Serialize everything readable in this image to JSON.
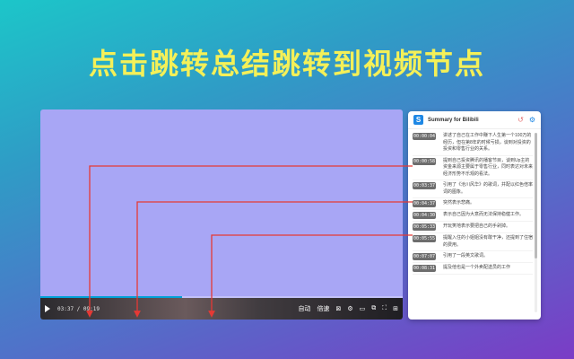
{
  "headline": "点击跳转总结跳转到视频节点",
  "player": {
    "time": "03:37 / 09:19",
    "progress": 0.39,
    "controls": [
      "自动",
      "倍速",
      "⊠",
      "⚙",
      "▭",
      "⧉",
      "⛶",
      "⊞"
    ]
  },
  "panel": {
    "logo_letter": "S",
    "title": "Summary for Bilibili",
    "undo_icon": "↺",
    "settings_icon": "⚙",
    "items": [
      {
        "time": "00:00:04",
        "text": "讲述了自己在工作中赚下人生第一个100万的经历，但在第8年的时候亏损，谈到对投资的投资和零售行业的关系。"
      },
      {
        "time": "00:00:58",
        "text": "提到自己投资腾讯的播客节目，谈到Up主的资金来源主要属于零售行业，同时表达对未来经济形势不乐观的看法。"
      },
      {
        "time": "00:03:37",
        "text": "引用了《沧川风华》的歌词，并配以红色倍率词的图象。"
      },
      {
        "time": "00:04:37",
        "text": "突然表示悲痛。"
      },
      {
        "time": "00:04:30",
        "text": "表示自己因为大意而无法保持稳健工作。"
      },
      {
        "time": "00:05:33",
        "text": "开玩笑地表示要把自己的手剁掉。"
      },
      {
        "time": "00:05:55",
        "text": "提醒入住的小姐姐没有敢干净，还提到了住宿的费用。"
      },
      {
        "time": "00:07:07",
        "text": "引用了一段英文歌词。"
      },
      {
        "time": "00:08:31",
        "text": "提及他也是一个外卖配送员的工作"
      }
    ]
  },
  "colors": {
    "accent_arrow": "#e53935",
    "headline": "#f4f058",
    "video": "#a8a6f5"
  }
}
